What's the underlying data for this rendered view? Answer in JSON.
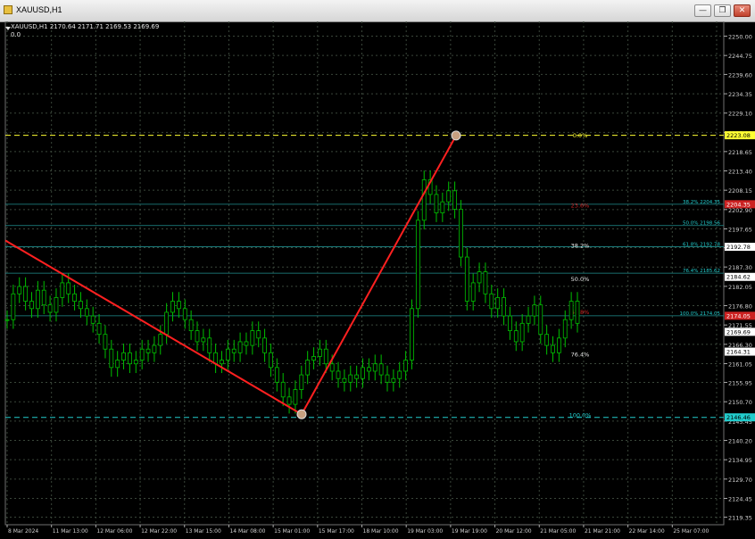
{
  "window": {
    "title": "XAUUSD,H1",
    "buttons": [
      "restore",
      "minimize",
      "close"
    ],
    "colors": {
      "background": "#000000",
      "grid": "#303a30",
      "candles": "#00c000",
      "trend": "#ff2020",
      "fib_cyan": "#22cccc",
      "fib_yellow": "#ffff33",
      "fib_red": "#cc2222"
    }
  },
  "header": {
    "symbol_line": "XAUUSD,H1  2170.64 2171.71 2169.53 2169.69",
    "indicator_value": "0.0"
  },
  "chart_data": {
    "type": "candlestick",
    "symbol": "XAUUSD",
    "timeframe": "H1",
    "ylim": [
      2117.3,
      2254.0
    ],
    "y_ticks": [
      "2250.00",
      "2244.75",
      "2239.60",
      "2234.35",
      "2229.10",
      "2223.85",
      "2218.65",
      "2213.40",
      "2208.15",
      "2202.90",
      "2197.65",
      "2192.55",
      "2187.30",
      "2182.05",
      "2176.80",
      "2171.55",
      "2166.30",
      "2161.05",
      "2155.95",
      "2150.70",
      "2145.45",
      "2140.20",
      "2134.95",
      "2129.70",
      "2124.45",
      "2119.35"
    ],
    "x_ticks": [
      "8 Mar 2024",
      "11 Mar 13:00",
      "12 Mar 06:00",
      "12 Mar 22:00",
      "13 Mar 15:00",
      "14 Mar 08:00",
      "15 Mar 01:00",
      "15 Mar 17:00",
      "18 Mar 10:00",
      "19 Mar 03:00",
      "19 Mar 19:00",
      "20 Mar 12:00",
      "21 Mar 05:00",
      "21 Mar 21:00",
      "22 Mar 14:00",
      "25 Mar 07:00"
    ],
    "close_path": [
      2173,
      2180,
      2182,
      2178,
      2176,
      2181,
      2177,
      2175,
      2179,
      2183,
      2180,
      2178,
      2176,
      2174,
      2172,
      2169,
      2165,
      2160,
      2162,
      2164,
      2161,
      2162,
      2165,
      2164,
      2166,
      2169,
      2175,
      2178,
      2176,
      2173,
      2170,
      2167,
      2168,
      2164,
      2161,
      2162,
      2165,
      2164,
      2167,
      2166,
      2170,
      2168,
      2164,
      2160,
      2156,
      2152,
      2150,
      2154,
      2158,
      2162,
      2163,
      2165,
      2161,
      2159,
      2157,
      2156,
      2158,
      2157,
      2160,
      2159,
      2161,
      2158,
      2156,
      2157,
      2159,
      2162,
      2176,
      2200,
      2211,
      2207,
      2202,
      2205,
      2208,
      2203,
      2190,
      2178,
      2183,
      2186,
      2180,
      2176,
      2179,
      2174,
      2170,
      2167,
      2172,
      2174,
      2177,
      2169,
      2166,
      2164,
      2168,
      2173,
      2178,
      2172
    ],
    "trend_lines": [
      {
        "from": 2194.5,
        "to": 2147.3
      },
      {
        "from": 2147.3,
        "to": 2223.0
      }
    ],
    "fib_retracement_left": [
      {
        "label": "38.2% 2204.35",
        "price": 2204.35
      },
      {
        "label": "50.0% 2198.56",
        "price": 2198.56
      },
      {
        "label": "61.8% 2192.78",
        "price": 2192.78
      },
      {
        "label": "76.4% 2185.62",
        "price": 2185.62
      },
      {
        "label": "100.0% 2174.05",
        "price": 2174.05
      }
    ],
    "fib_retracement_right": [
      {
        "label": "0.0%",
        "price": 2223.0,
        "color": "#ffff33"
      },
      {
        "label": "23.6%",
        "price": 2204.0,
        "color": "#cc2222"
      },
      {
        "label": "38.2%",
        "price": 2193.0,
        "color": "#e6e6e6"
      },
      {
        "label": "50.0%",
        "price": 2184.0,
        "color": "#e6e6e6"
      },
      {
        "label": "61.8%",
        "price": 2175.0,
        "color": "#cc2222"
      },
      {
        "label": "76.4%",
        "price": 2163.5,
        "color": "#e6e6e6"
      },
      {
        "label": "100.0%",
        "price": 2147.0,
        "color": "#22cccc"
      }
    ],
    "price_tags": [
      {
        "label": "2223.08",
        "price": 2223.08,
        "bg": "#ffff33",
        "fg": "#000000"
      },
      {
        "label": "2204.35",
        "price": 2204.35,
        "bg": "#cc2222",
        "fg": "#ffffff"
      },
      {
        "label": "2192.78",
        "price": 2192.78,
        "bg": "#ffffff",
        "fg": "#000000"
      },
      {
        "label": "2184.62",
        "price": 2184.62,
        "bg": "#ffffff",
        "fg": "#000000"
      },
      {
        "label": "2174.05",
        "price": 2174.05,
        "bg": "#cc2222",
        "fg": "#ffffff"
      },
      {
        "label": "2169.69",
        "price": 2169.69,
        "bg": "#ffffff",
        "fg": "#000000"
      },
      {
        "label": "2164.31",
        "price": 2164.31,
        "bg": "#ffffff",
        "fg": "#000000"
      },
      {
        "label": "2146.46",
        "price": 2146.46,
        "bg": "#22cccc",
        "fg": "#000000"
      }
    ],
    "horizontal_lines": [
      {
        "price": 2223.08,
        "color": "#ffff33",
        "dashed": true
      },
      {
        "price": 2146.46,
        "color": "#22cccc",
        "dashed": true
      }
    ]
  }
}
